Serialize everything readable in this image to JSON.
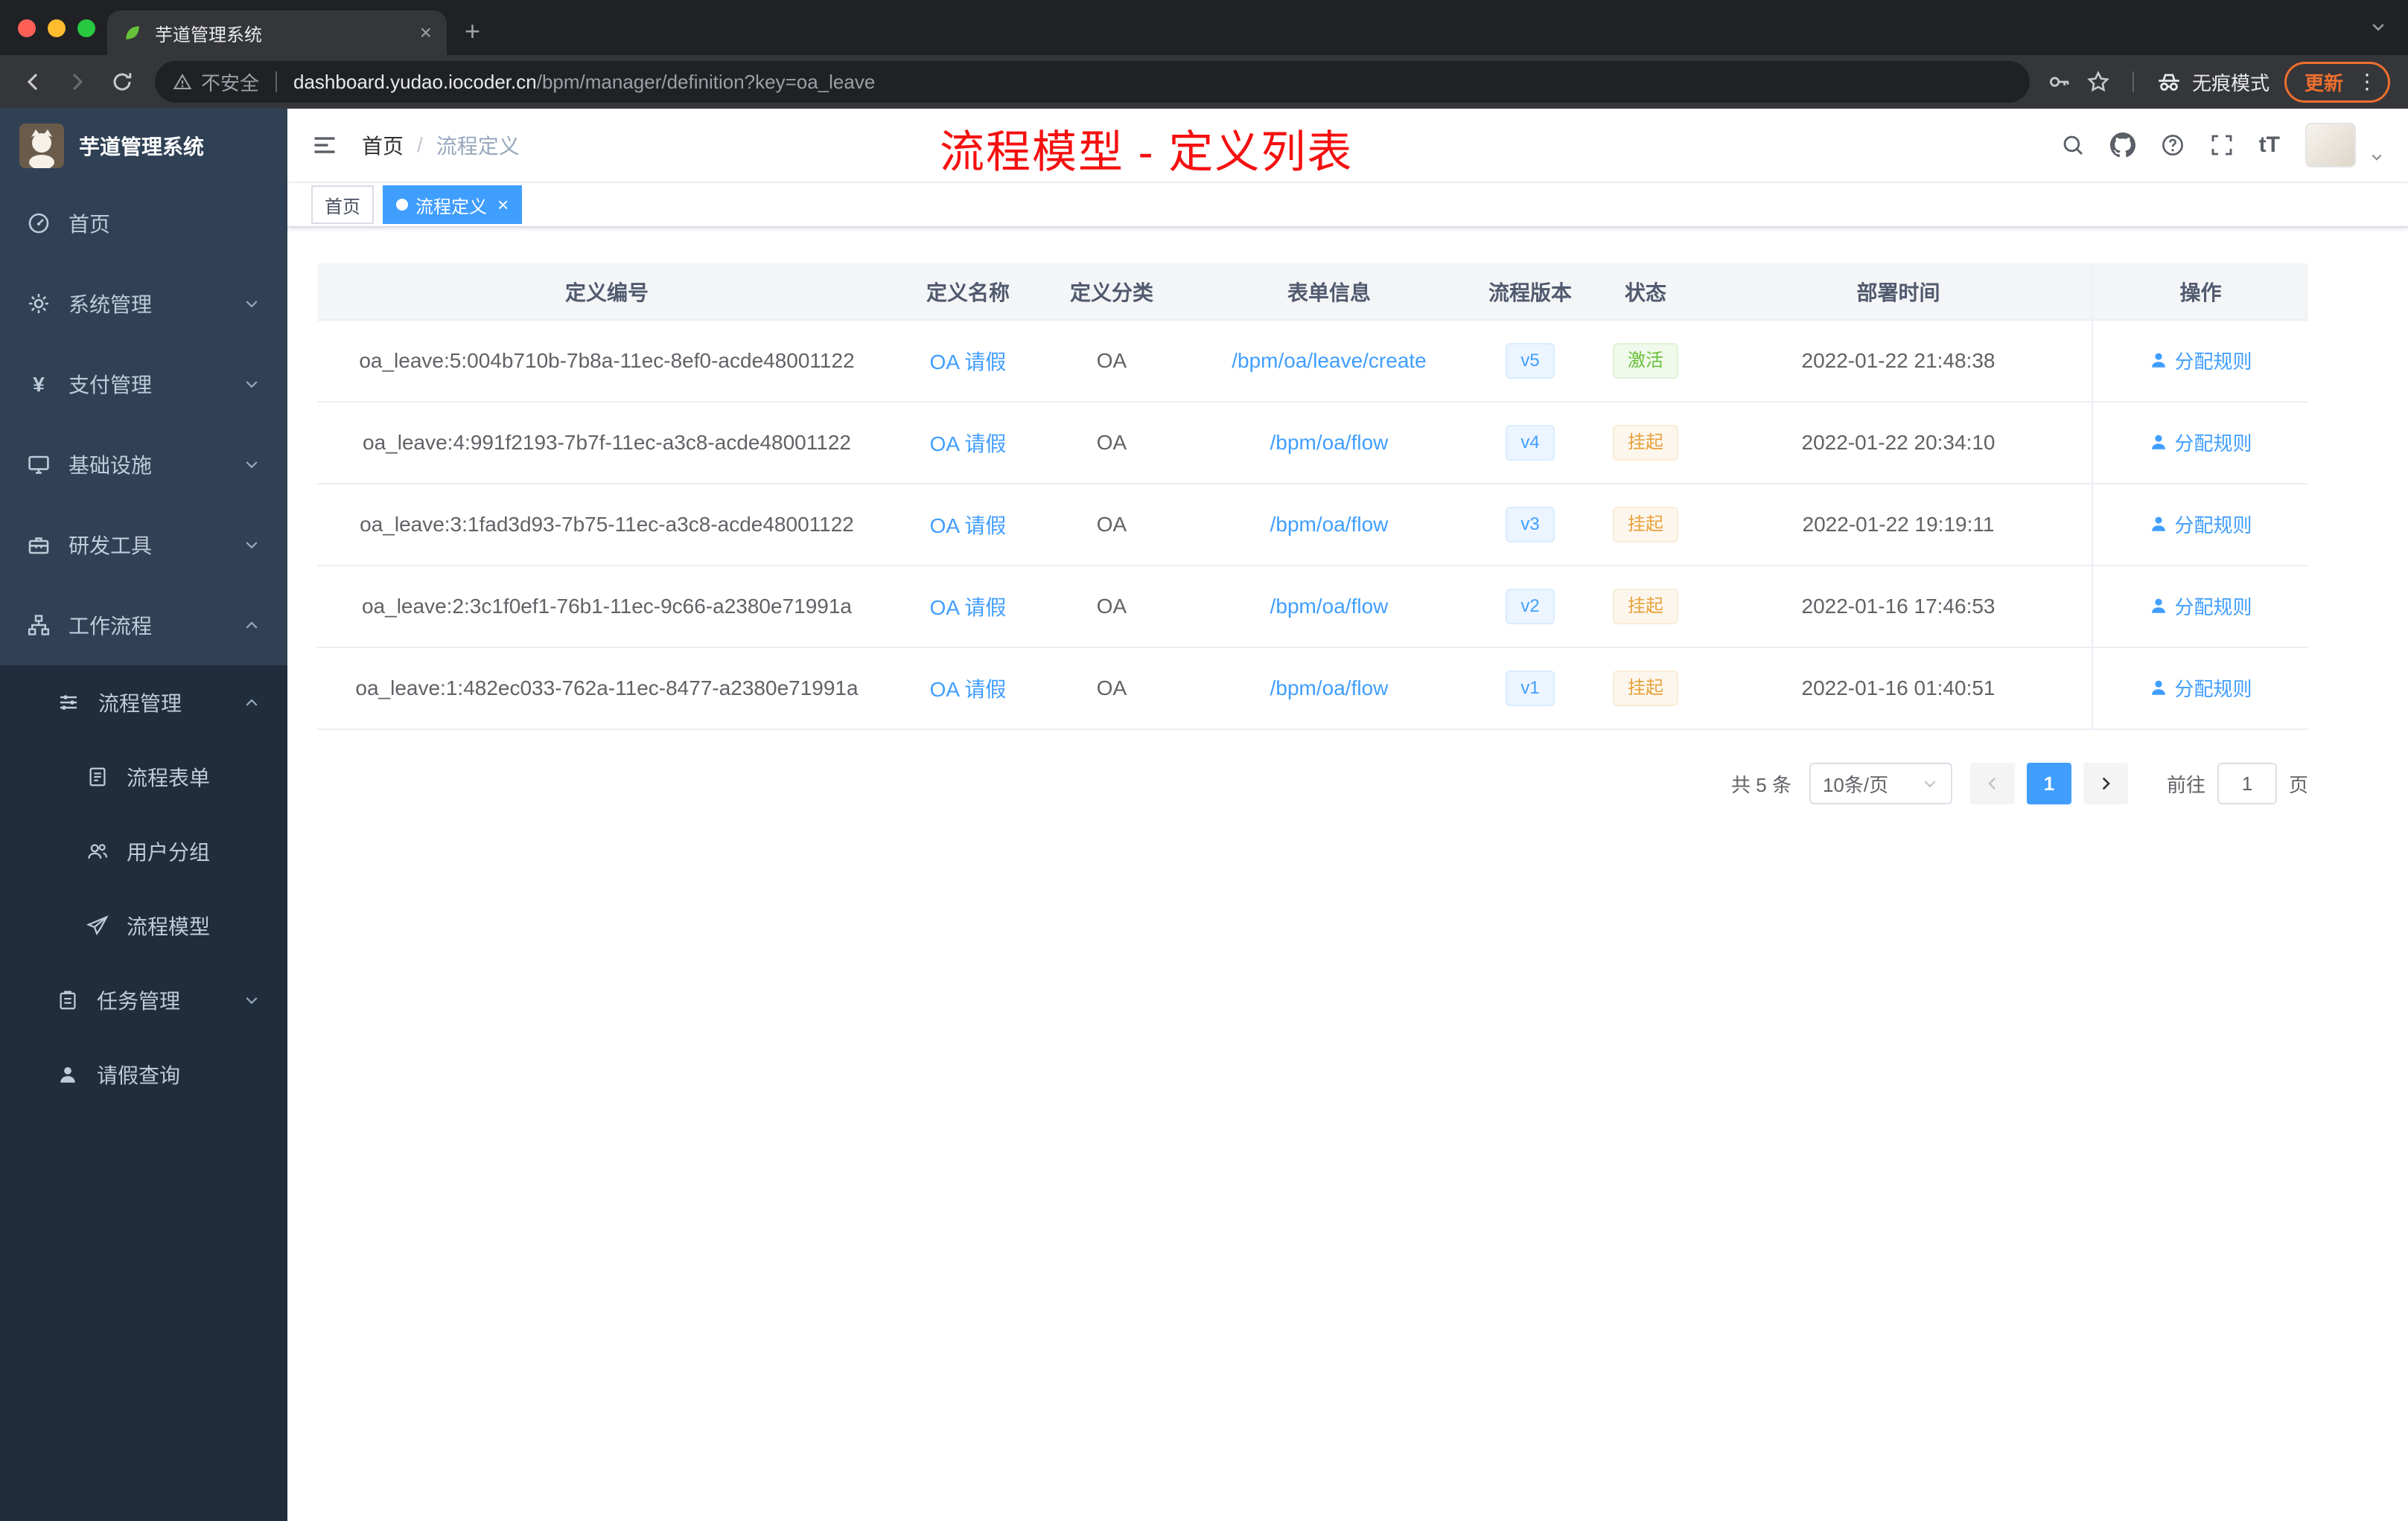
{
  "colors": {
    "accent": "#409eff",
    "red": "#f51010",
    "success": "#67c23a",
    "warning": "#e6a23c"
  },
  "browser": {
    "tab_title": "芋道管理系统",
    "security_label": "不安全",
    "url_host": "dashboard.yudao.iocoder.cn",
    "url_path": "/bpm/manager/definition?key=oa_leave",
    "incognito_label": "无痕模式",
    "update_label": "更新"
  },
  "sidebar": {
    "app_title": "芋道管理系统",
    "menu": [
      {
        "label": "首页"
      },
      {
        "label": "系统管理"
      },
      {
        "label": "支付管理"
      },
      {
        "label": "基础设施"
      },
      {
        "label": "研发工具"
      },
      {
        "label": "工作流程"
      }
    ],
    "submenu": {
      "process_mgmt": "流程管理",
      "process_children": [
        {
          "label": "流程表单"
        },
        {
          "label": "用户分组"
        },
        {
          "label": "流程模型"
        }
      ],
      "task_mgmt": "任务管理",
      "leave_query": "请假查询"
    }
  },
  "header": {
    "breadcrumb_home": "首页",
    "breadcrumb_current": "流程定义",
    "annotation": "流程模型 - 定义列表",
    "font_icon": "tT"
  },
  "tags": {
    "home": "首页",
    "active": "流程定义"
  },
  "table": {
    "columns": [
      "定义编号",
      "定义名称",
      "定义分类",
      "表单信息",
      "流程版本",
      "状态",
      "部署时间",
      "操作"
    ],
    "rows": [
      {
        "id": "oa_leave:5:004b710b-7b8a-11ec-8ef0-acde48001122",
        "name": "OA 请假",
        "category": "OA",
        "form": "/bpm/oa/leave/create",
        "version": "v5",
        "status": "激活",
        "status_class": "success",
        "deploy_time": "2022-01-22 21:48:38",
        "action": "分配规则"
      },
      {
        "id": "oa_leave:4:991f2193-7b7f-11ec-a3c8-acde48001122",
        "name": "OA 请假",
        "category": "OA",
        "form": "/bpm/oa/flow",
        "version": "v4",
        "status": "挂起",
        "status_class": "warning",
        "deploy_time": "2022-01-22 20:34:10",
        "action": "分配规则"
      },
      {
        "id": "oa_leave:3:1fad3d93-7b75-11ec-a3c8-acde48001122",
        "name": "OA 请假",
        "category": "OA",
        "form": "/bpm/oa/flow",
        "version": "v3",
        "status": "挂起",
        "status_class": "warning",
        "deploy_time": "2022-01-22 19:19:11",
        "action": "分配规则"
      },
      {
        "id": "oa_leave:2:3c1f0ef1-76b1-11ec-9c66-a2380e71991a",
        "name": "OA 请假",
        "category": "OA",
        "form": "/bpm/oa/flow",
        "version": "v2",
        "status": "挂起",
        "status_class": "warning",
        "deploy_time": "2022-01-16 17:46:53",
        "action": "分配规则"
      },
      {
        "id": "oa_leave:1:482ec033-762a-11ec-8477-a2380e71991a",
        "name": "OA 请假",
        "category": "OA",
        "form": "/bpm/oa/flow",
        "version": "v1",
        "status": "挂起",
        "status_class": "warning",
        "deploy_time": "2022-01-16 01:40:51",
        "action": "分配规则"
      }
    ]
  },
  "pagination": {
    "total": "共 5 条",
    "page_size": "10条/页",
    "current_page": "1",
    "goto_label": "前往",
    "goto_value": "1",
    "unit_label": "页"
  }
}
